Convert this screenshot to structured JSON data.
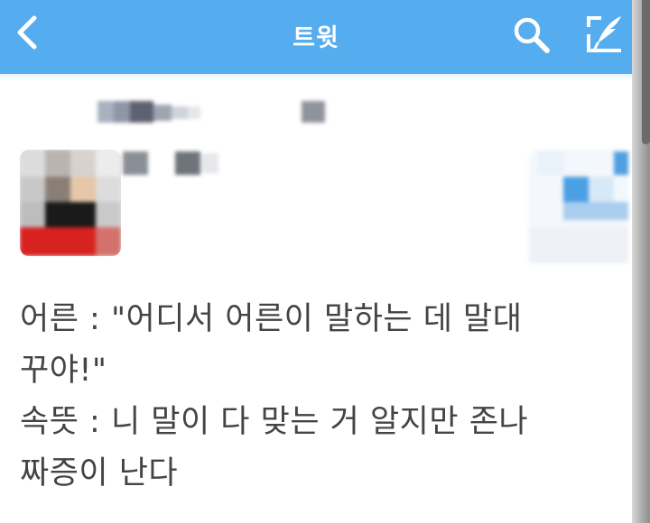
{
  "navbar": {
    "title": "트윗",
    "back_icon": "chevron-left-icon",
    "search_icon": "search-icon",
    "compose_icon": "compose-quill-icon",
    "color": "#55acee"
  },
  "tweet": {
    "lines": [
      "어른 : \"어디서 어른이 말하는 데 말대",
      "꾸야!\"",
      "속뜻 : 니 말이 다 맞는 거 알지만 존나",
      "짜증이 난다"
    ]
  }
}
